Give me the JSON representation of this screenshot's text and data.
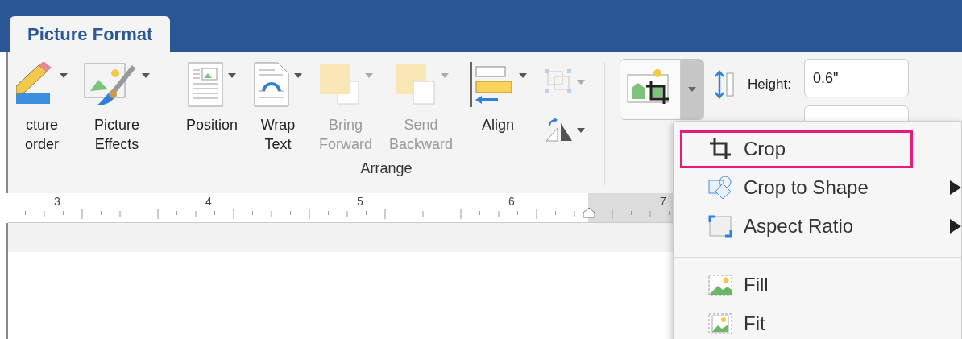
{
  "tabs": [
    {
      "label": "Picture Format",
      "selected": true
    }
  ],
  "ribbon": {
    "groups": [
      {
        "buttons": [
          {
            "kind": "border",
            "label": "cture\norder",
            "disabled": false
          },
          {
            "kind": "effects",
            "label": "Picture\nEffects",
            "disabled": false
          }
        ]
      },
      {
        "label": "Arrange",
        "buttons": [
          {
            "kind": "position",
            "label": "Position",
            "disabled": false
          },
          {
            "kind": "wrap",
            "label": "Wrap\nText",
            "disabled": false
          },
          {
            "kind": "bring_forward",
            "label": "Bring\nForward",
            "disabled": true
          },
          {
            "kind": "send_backward",
            "label": "Send\nBackward",
            "disabled": true
          },
          {
            "kind": "align",
            "label": "Align",
            "disabled": false
          }
        ],
        "small_buttons": [
          {
            "kind": "group",
            "disabled": true
          },
          {
            "kind": "rotate",
            "disabled": false
          }
        ]
      }
    ]
  },
  "crop_button": {
    "expanded": true
  },
  "size": {
    "label": "Height:",
    "value": "0.6\""
  },
  "ruler": {
    "labels": [
      "3",
      "4",
      "5",
      "6",
      "7"
    ]
  },
  "menu": {
    "sections": [
      [
        {
          "kind": "crop",
          "label": "Crop",
          "highlighted": true,
          "submenu": false
        },
        {
          "kind": "crop_shape",
          "label": "Crop to Shape",
          "highlighted": false,
          "submenu": true
        },
        {
          "kind": "aspect",
          "label": "Aspect Ratio",
          "highlighted": false,
          "submenu": true
        }
      ],
      [
        {
          "kind": "fill",
          "label": "Fill",
          "highlighted": false,
          "submenu": false
        },
        {
          "kind": "fit",
          "label": "Fit",
          "highlighted": false,
          "submenu": false
        }
      ]
    ]
  }
}
